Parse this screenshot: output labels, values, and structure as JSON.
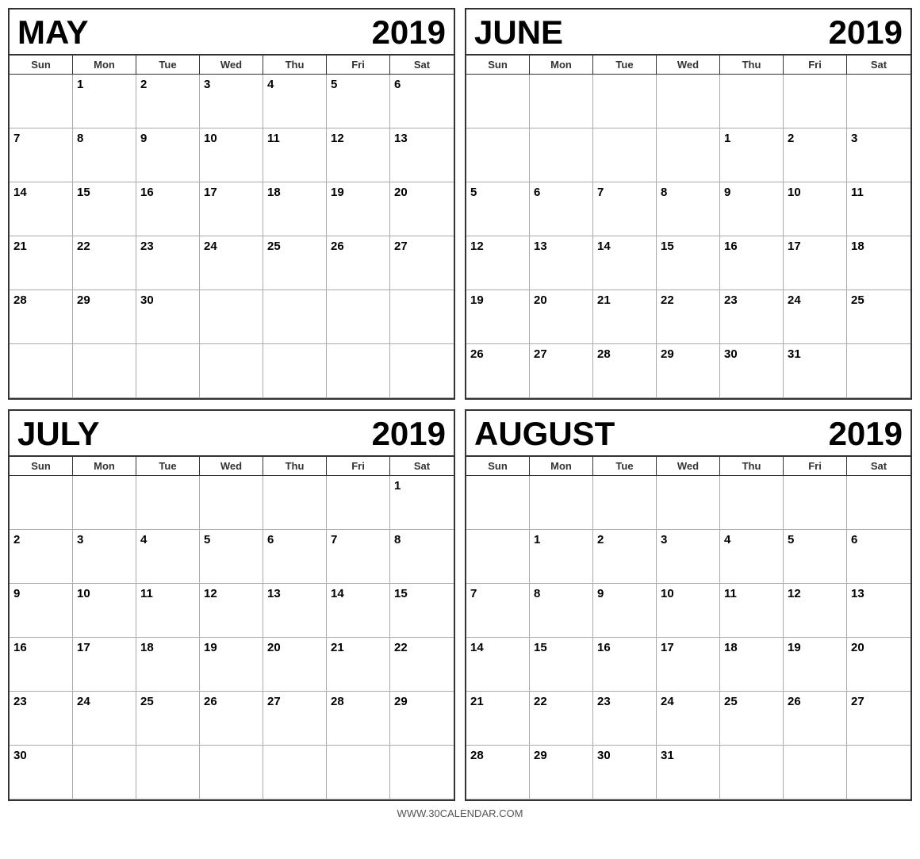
{
  "footer": "WWW.30CALENDAR.COM",
  "calendars": [
    {
      "id": "may-2019",
      "month": "MAY",
      "year": "2019",
      "dayNames": [
        "Sun",
        "Mon",
        "Tue",
        "Wed",
        "Thu",
        "Fri",
        "Sat"
      ],
      "weeks": [
        [
          "",
          "1",
          "2",
          "3",
          "4",
          "5",
          "6"
        ],
        [
          "7",
          "8",
          "9",
          "10",
          "11",
          "12",
          "13"
        ],
        [
          "14",
          "15",
          "16",
          "17",
          "18",
          "19",
          "20"
        ],
        [
          "21",
          "22",
          "23",
          "24",
          "25",
          "26",
          "27"
        ],
        [
          "28",
          "29",
          "30",
          "",
          "",
          "",
          ""
        ],
        [
          "",
          "",
          "",
          "",
          "",
          "",
          ""
        ]
      ]
    },
    {
      "id": "june-2019",
      "month": "JUNE",
      "year": "2019",
      "dayNames": [
        "Sun",
        "Mon",
        "Tue",
        "Wed",
        "Thu",
        "Fri",
        "Sat"
      ],
      "weeks": [
        [
          "",
          "",
          "",
          "",
          "",
          "",
          ""
        ],
        [
          "",
          "",
          "",
          "",
          "1",
          "2",
          "3"
        ],
        [
          "5",
          "6",
          "7",
          "8",
          "9",
          "10",
          "11"
        ],
        [
          "12",
          "13",
          "14",
          "15",
          "16",
          "17",
          "18"
        ],
        [
          "19",
          "20",
          "21",
          "22",
          "23",
          "24",
          "25"
        ],
        [
          "26",
          "27",
          "28",
          "29",
          "30",
          "31",
          ""
        ]
      ]
    },
    {
      "id": "july-2019",
      "month": "JULY",
      "year": "2019",
      "dayNames": [
        "Sun",
        "Mon",
        "Tue",
        "Wed",
        "Thu",
        "Fri",
        "Sat"
      ],
      "weeks": [
        [
          "",
          "",
          "",
          "",
          "",
          "",
          "1"
        ],
        [
          "2",
          "3",
          "4",
          "5",
          "6",
          "7",
          "8"
        ],
        [
          "9",
          "10",
          "11",
          "12",
          "13",
          "14",
          "15"
        ],
        [
          "16",
          "17",
          "18",
          "19",
          "20",
          "21",
          "22"
        ],
        [
          "23",
          "24",
          "25",
          "26",
          "27",
          "28",
          "29"
        ],
        [
          "30",
          "",
          "",
          "",
          "",
          "",
          ""
        ]
      ]
    },
    {
      "id": "august-2019",
      "month": "AUGUST",
      "year": "2019",
      "dayNames": [
        "Sun",
        "Mon",
        "Tue",
        "Wed",
        "Thu",
        "Fri",
        "Sat"
      ],
      "weeks": [
        [
          "",
          "",
          "",
          "",
          "",
          "",
          ""
        ],
        [
          "",
          "1",
          "2",
          "3",
          "4",
          "5",
          "6"
        ],
        [
          "7",
          "8",
          "9",
          "10",
          "11",
          "12",
          "13"
        ],
        [
          "14",
          "15",
          "16",
          "17",
          "18",
          "19",
          "20"
        ],
        [
          "21",
          "22",
          "23",
          "24",
          "25",
          "26",
          "27"
        ],
        [
          "28",
          "29",
          "30",
          "31",
          "",
          "",
          ""
        ]
      ]
    }
  ]
}
